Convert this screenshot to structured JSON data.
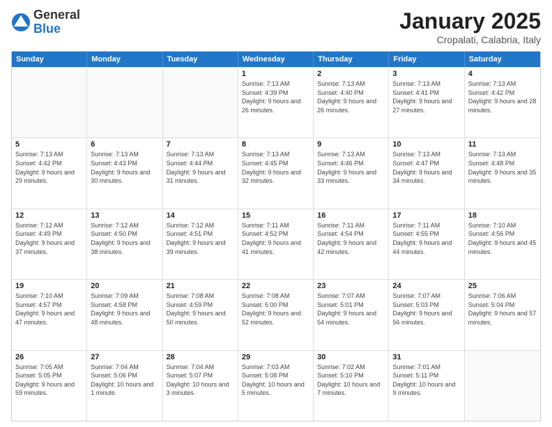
{
  "logo": {
    "general": "General",
    "blue": "Blue"
  },
  "title": {
    "month": "January 2025",
    "location": "Cropalati, Calabria, Italy"
  },
  "headers": [
    "Sunday",
    "Monday",
    "Tuesday",
    "Wednesday",
    "Thursday",
    "Friday",
    "Saturday"
  ],
  "weeks": [
    [
      {
        "day": "",
        "info": ""
      },
      {
        "day": "",
        "info": ""
      },
      {
        "day": "",
        "info": ""
      },
      {
        "day": "1",
        "info": "Sunrise: 7:13 AM\nSunset: 4:39 PM\nDaylight: 9 hours and 26 minutes."
      },
      {
        "day": "2",
        "info": "Sunrise: 7:13 AM\nSunset: 4:40 PM\nDaylight: 9 hours and 26 minutes."
      },
      {
        "day": "3",
        "info": "Sunrise: 7:13 AM\nSunset: 4:41 PM\nDaylight: 9 hours and 27 minutes."
      },
      {
        "day": "4",
        "info": "Sunrise: 7:13 AM\nSunset: 4:42 PM\nDaylight: 9 hours and 28 minutes."
      }
    ],
    [
      {
        "day": "5",
        "info": "Sunrise: 7:13 AM\nSunset: 4:42 PM\nDaylight: 9 hours and 29 minutes."
      },
      {
        "day": "6",
        "info": "Sunrise: 7:13 AM\nSunset: 4:43 PM\nDaylight: 9 hours and 30 minutes."
      },
      {
        "day": "7",
        "info": "Sunrise: 7:13 AM\nSunset: 4:44 PM\nDaylight: 9 hours and 31 minutes."
      },
      {
        "day": "8",
        "info": "Sunrise: 7:13 AM\nSunset: 4:45 PM\nDaylight: 9 hours and 32 minutes."
      },
      {
        "day": "9",
        "info": "Sunrise: 7:13 AM\nSunset: 4:46 PM\nDaylight: 9 hours and 33 minutes."
      },
      {
        "day": "10",
        "info": "Sunrise: 7:13 AM\nSunset: 4:47 PM\nDaylight: 9 hours and 34 minutes."
      },
      {
        "day": "11",
        "info": "Sunrise: 7:13 AM\nSunset: 4:48 PM\nDaylight: 9 hours and 35 minutes."
      }
    ],
    [
      {
        "day": "12",
        "info": "Sunrise: 7:12 AM\nSunset: 4:49 PM\nDaylight: 9 hours and 37 minutes."
      },
      {
        "day": "13",
        "info": "Sunrise: 7:12 AM\nSunset: 4:50 PM\nDaylight: 9 hours and 38 minutes."
      },
      {
        "day": "14",
        "info": "Sunrise: 7:12 AM\nSunset: 4:51 PM\nDaylight: 9 hours and 39 minutes."
      },
      {
        "day": "15",
        "info": "Sunrise: 7:11 AM\nSunset: 4:52 PM\nDaylight: 9 hours and 41 minutes."
      },
      {
        "day": "16",
        "info": "Sunrise: 7:11 AM\nSunset: 4:54 PM\nDaylight: 9 hours and 42 minutes."
      },
      {
        "day": "17",
        "info": "Sunrise: 7:11 AM\nSunset: 4:55 PM\nDaylight: 9 hours and 44 minutes."
      },
      {
        "day": "18",
        "info": "Sunrise: 7:10 AM\nSunset: 4:56 PM\nDaylight: 9 hours and 45 minutes."
      }
    ],
    [
      {
        "day": "19",
        "info": "Sunrise: 7:10 AM\nSunset: 4:57 PM\nDaylight: 9 hours and 47 minutes."
      },
      {
        "day": "20",
        "info": "Sunrise: 7:09 AM\nSunset: 4:58 PM\nDaylight: 9 hours and 48 minutes."
      },
      {
        "day": "21",
        "info": "Sunrise: 7:08 AM\nSunset: 4:59 PM\nDaylight: 9 hours and 50 minutes."
      },
      {
        "day": "22",
        "info": "Sunrise: 7:08 AM\nSunset: 5:00 PM\nDaylight: 9 hours and 52 minutes."
      },
      {
        "day": "23",
        "info": "Sunrise: 7:07 AM\nSunset: 5:01 PM\nDaylight: 9 hours and 54 minutes."
      },
      {
        "day": "24",
        "info": "Sunrise: 7:07 AM\nSunset: 5:03 PM\nDaylight: 9 hours and 56 minutes."
      },
      {
        "day": "25",
        "info": "Sunrise: 7:06 AM\nSunset: 5:04 PM\nDaylight: 9 hours and 57 minutes."
      }
    ],
    [
      {
        "day": "26",
        "info": "Sunrise: 7:05 AM\nSunset: 5:05 PM\nDaylight: 9 hours and 59 minutes."
      },
      {
        "day": "27",
        "info": "Sunrise: 7:04 AM\nSunset: 5:06 PM\nDaylight: 10 hours and 1 minute."
      },
      {
        "day": "28",
        "info": "Sunrise: 7:04 AM\nSunset: 5:07 PM\nDaylight: 10 hours and 3 minutes."
      },
      {
        "day": "29",
        "info": "Sunrise: 7:03 AM\nSunset: 5:08 PM\nDaylight: 10 hours and 5 minutes."
      },
      {
        "day": "30",
        "info": "Sunrise: 7:02 AM\nSunset: 5:10 PM\nDaylight: 10 hours and 7 minutes."
      },
      {
        "day": "31",
        "info": "Sunrise: 7:01 AM\nSunset: 5:11 PM\nDaylight: 10 hours and 9 minutes."
      },
      {
        "day": "",
        "info": ""
      }
    ]
  ]
}
